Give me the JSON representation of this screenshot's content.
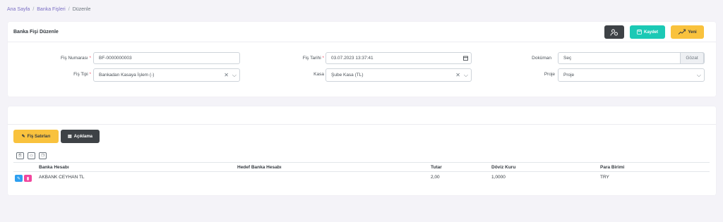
{
  "breadcrumb": {
    "home": "Ana Sayfa",
    "list": "Banka Fişleri",
    "current": "Düzenle",
    "sep": "/"
  },
  "header": {
    "title": "Banka Fişi Düzenle",
    "save_label": "Kaydet",
    "new_label": "Yeni"
  },
  "form": {
    "fis_no_label": "Fiş Numarası",
    "fis_no_value": "BF-0000000003",
    "fis_tipi_label": "Fiş Tipi",
    "fis_tipi_value": "Bankadan Kasaya İşlem (-)",
    "fis_tarihi_label": "Fiş Tarihi",
    "fis_tarihi_value": "03.07.2023 13:37:41",
    "kasa_label": "Kasa",
    "kasa_value": "Şube Kasa (TL)",
    "dokuman_label": "Doküman",
    "dokuman_value": "Seç",
    "gozat_label": "Gözat",
    "proje_label": "Proje",
    "proje_value": "Proje",
    "required_mark": "*"
  },
  "tabs": {
    "lines_label": "Fiş Satırları",
    "desc_label": "Açıklama"
  },
  "table": {
    "headers": [
      "Banka Hesabı",
      "Hedef Banka Hesabı",
      "Tutar",
      "Döviz Kuru",
      "Para Birimi"
    ],
    "rows": [
      [
        "AKBANK CEYHAN TL",
        "",
        "2,00",
        "1,0000",
        "TRY"
      ]
    ]
  },
  "colors": {
    "accent": "#7b6fc4",
    "success": "#1bc9b5",
    "warning": "#f9c23d",
    "dark": "#3e4246",
    "danger": "#f1469d",
    "info": "#2d9ff0"
  }
}
